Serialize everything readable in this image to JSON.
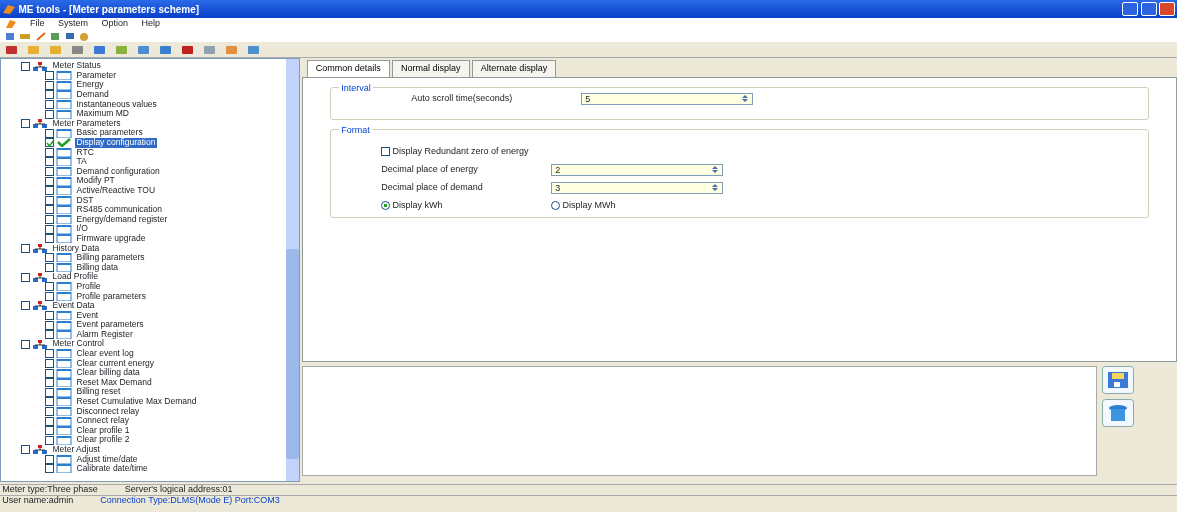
{
  "window": {
    "title": "ME tools - [Meter parameters scheme]"
  },
  "menu": [
    "File",
    "System",
    "Option",
    "Help"
  ],
  "tree": [
    {
      "label": "Meter Status",
      "checked": false,
      "selected": false,
      "children": [
        {
          "label": "Parameter",
          "checked": false,
          "selected": false
        },
        {
          "label": "Energy",
          "checked": false,
          "selected": false
        },
        {
          "label": "Demand",
          "checked": false,
          "selected": false
        },
        {
          "label": "Instantaneous values",
          "checked": false,
          "selected": false
        },
        {
          "label": "Maximum MD",
          "checked": false,
          "selected": false
        }
      ]
    },
    {
      "label": "Meter Parameters",
      "checked": false,
      "selected": false,
      "children": [
        {
          "label": "Basic parameters",
          "checked": false,
          "selected": false
        },
        {
          "label": "Display configuration",
          "checked": true,
          "selected": true
        },
        {
          "label": "RTC",
          "checked": false,
          "selected": false
        },
        {
          "label": "TA",
          "checked": false,
          "selected": false
        },
        {
          "label": "Demand configuration",
          "checked": false,
          "selected": false
        },
        {
          "label": "Modify PT",
          "checked": false,
          "selected": false
        },
        {
          "label": "Active/Reactive TOU",
          "checked": false,
          "selected": false
        },
        {
          "label": "DST",
          "checked": false,
          "selected": false
        },
        {
          "label": "RS485 communication",
          "checked": false,
          "selected": false
        },
        {
          "label": "Energy/demand register",
          "checked": false,
          "selected": false
        },
        {
          "label": "I/O",
          "checked": false,
          "selected": false
        },
        {
          "label": "Firmware upgrade",
          "checked": false,
          "selected": false
        }
      ]
    },
    {
      "label": "History Data",
      "checked": false,
      "selected": false,
      "children": [
        {
          "label": "Billing parameters",
          "checked": false,
          "selected": false
        },
        {
          "label": "Billing data",
          "checked": false,
          "selected": false
        }
      ]
    },
    {
      "label": "Load Profile",
      "checked": false,
      "selected": false,
      "children": [
        {
          "label": "Profile",
          "checked": false,
          "selected": false
        },
        {
          "label": "Profile parameters",
          "checked": false,
          "selected": false
        }
      ]
    },
    {
      "label": "Event Data",
      "checked": false,
      "selected": false,
      "children": [
        {
          "label": "Event",
          "checked": false,
          "selected": false
        },
        {
          "label": "Event parameters",
          "checked": false,
          "selected": false
        },
        {
          "label": "Alarm Register",
          "checked": false,
          "selected": false
        }
      ]
    },
    {
      "label": "Meter Control",
      "checked": false,
      "selected": false,
      "children": [
        {
          "label": "Clear event log",
          "checked": false,
          "selected": false
        },
        {
          "label": "Clear current energy",
          "checked": false,
          "selected": false
        },
        {
          "label": "Clear billing data",
          "checked": false,
          "selected": false
        },
        {
          "label": "Reset Max Demand",
          "checked": false,
          "selected": false
        },
        {
          "label": "Billing reset",
          "checked": false,
          "selected": false
        },
        {
          "label": "Reset Cumulative Max Demand",
          "checked": false,
          "selected": false
        },
        {
          "label": "Disconnect relay",
          "checked": false,
          "selected": false
        },
        {
          "label": "Connect relay",
          "checked": false,
          "selected": false
        },
        {
          "label": "Clear profile 1",
          "checked": false,
          "selected": false
        },
        {
          "label": "Clear profile 2",
          "checked": false,
          "selected": false
        }
      ]
    },
    {
      "label": "Meter Adjust",
      "checked": false,
      "selected": false,
      "children": [
        {
          "label": "Adjust time/date",
          "checked": false,
          "selected": false
        },
        {
          "label": "Calibrate date/time",
          "checked": false,
          "selected": false
        }
      ]
    }
  ],
  "panel_status": [
    "Meter type:Three phase",
    "Server's logical address:01"
  ],
  "tabs": [
    {
      "label": "Common details",
      "selected": true
    },
    {
      "label": "Normal display",
      "selected": false
    },
    {
      "label": "Alternate display",
      "selected": false
    }
  ],
  "interval": {
    "title": "Interval",
    "fields": [
      {
        "label": "Auto scroll time(seconds)",
        "value": "5"
      }
    ]
  },
  "format": {
    "title": "Format",
    "checkbox": {
      "label": "Display Redundant zero of energy",
      "checked": false
    },
    "fields": [
      {
        "label": "Decimal place of energy",
        "value": "2"
      },
      {
        "label": "Decimal place of demand",
        "value": "3"
      }
    ],
    "radios": [
      {
        "label": "Display kWh",
        "selected": true
      },
      {
        "label": "Display MWh",
        "selected": false
      }
    ]
  },
  "status_bar": [
    "User name:admin",
    "Connection Type:DLMS(Mode E) Port:COM3"
  ]
}
